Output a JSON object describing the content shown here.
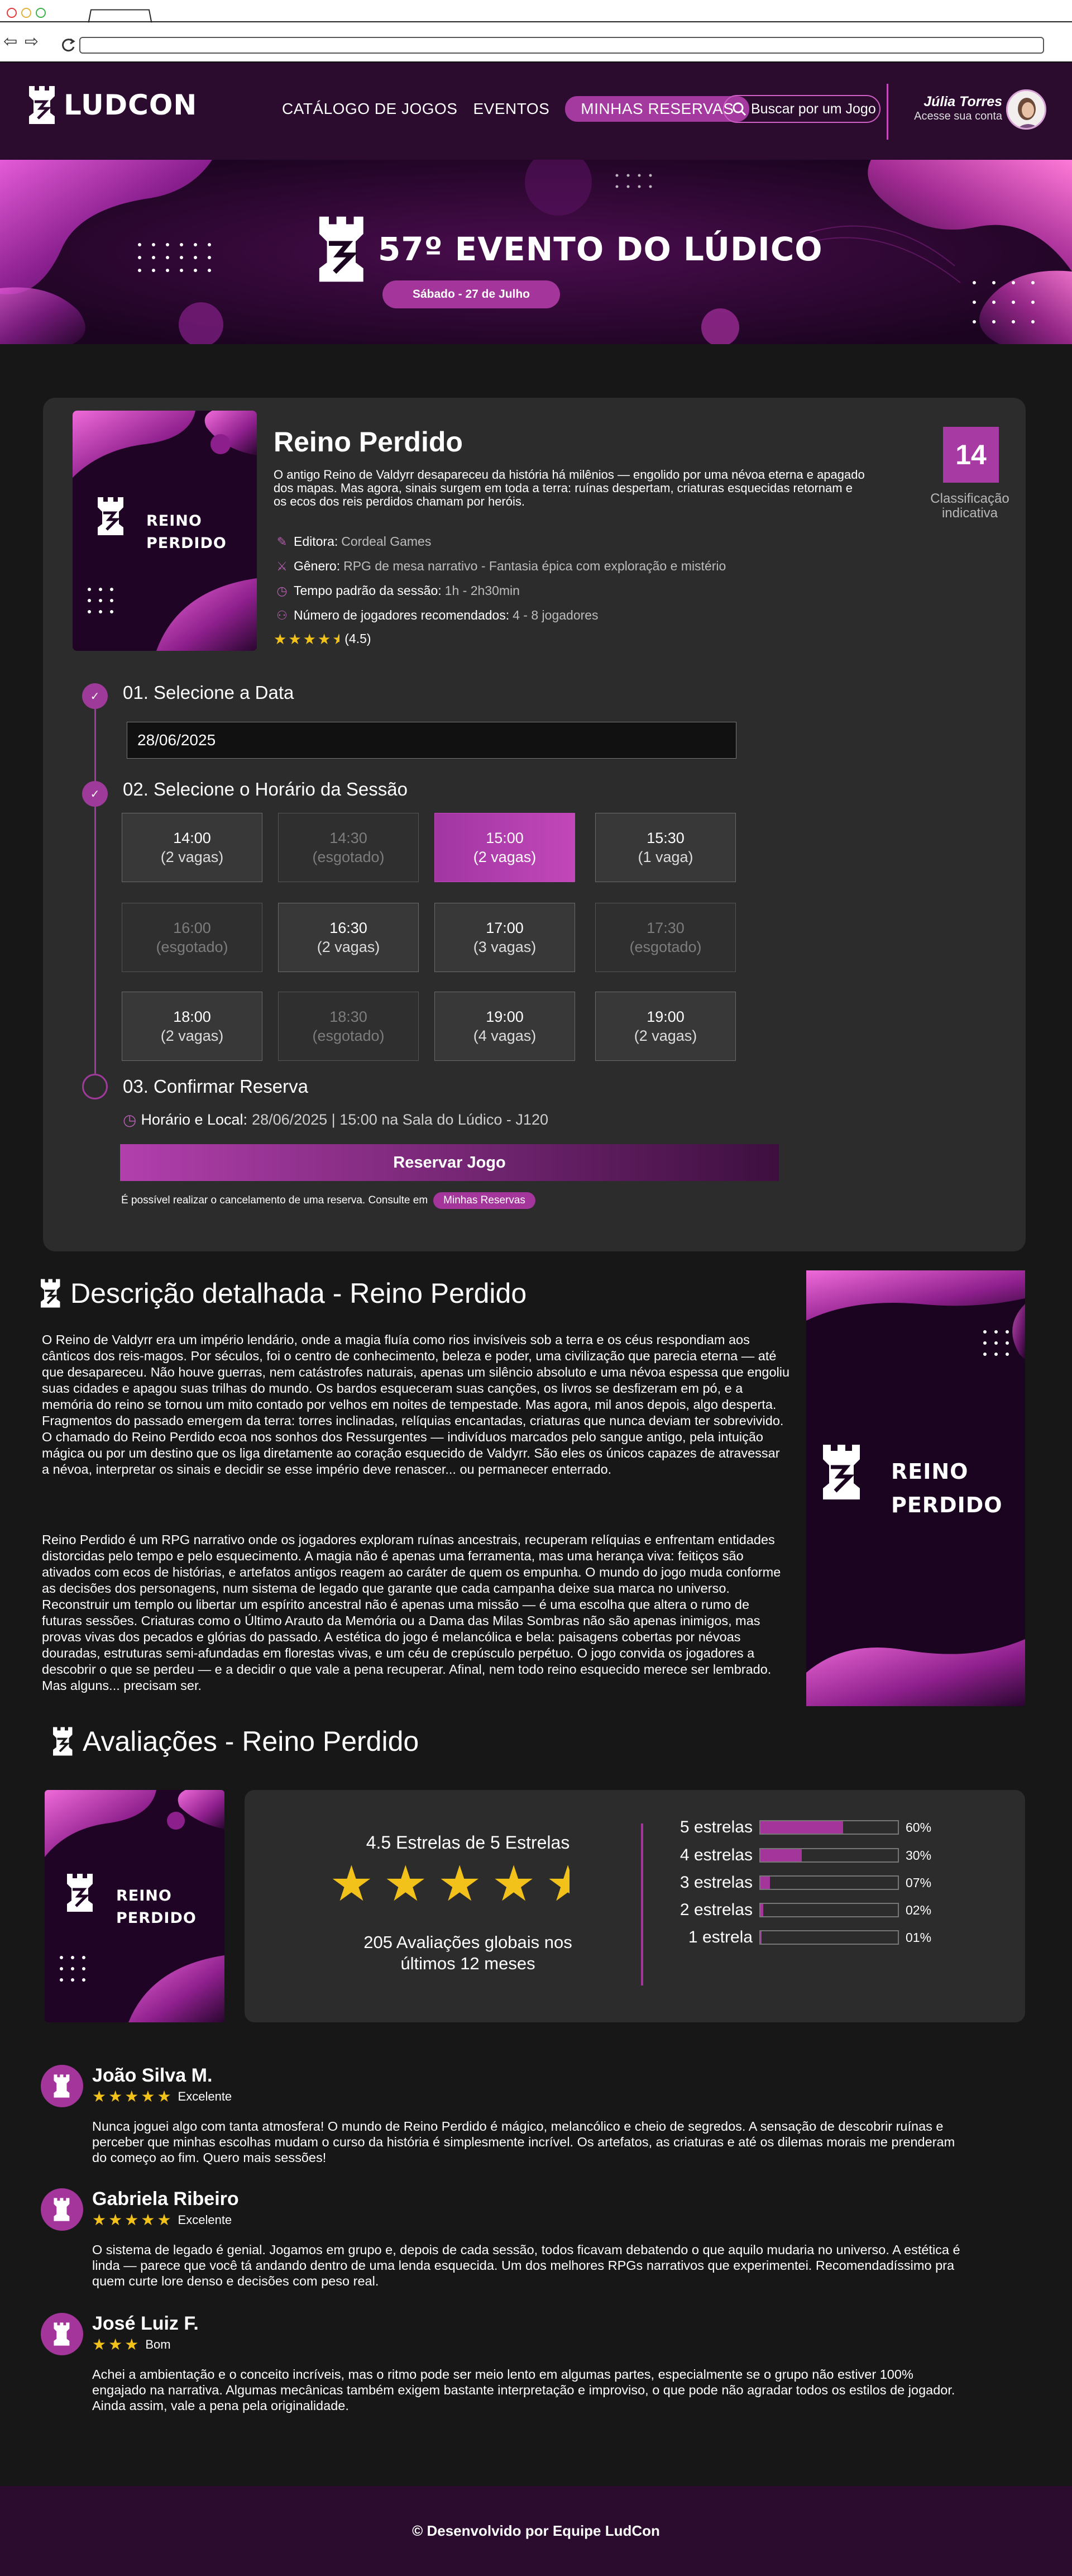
{
  "header": {
    "logo_text": "LUDCON",
    "nav": [
      "CATÁLOGO DE JOGOS",
      "EVENTOS",
      "MINHAS RESERVAS"
    ],
    "search_placeholder": "Buscar por um Jogo",
    "user_name": "Júlia Torres",
    "user_sub": "Acesse sua conta"
  },
  "banner": {
    "title": "57º EVENTO DO LÚDICO",
    "date": "Sábado - 27 de Julho"
  },
  "game": {
    "cover_text": "REINO PERDIDO",
    "cover_line1": "REINO",
    "cover_line2": "PERDIDO",
    "title": "Reino Perdido",
    "description": "O antigo Reino de Valdyrr desapareceu da história há milênios — engolido por uma névoa eterna e apagado dos mapas. Mas agora, sinais surgem em toda a terra: ruínas despertam, criaturas esquecidas retornam e os ecos dos reis perdidos chamam por heróis.",
    "publisher_label": "Editora:",
    "publisher": "Cordeal Games",
    "genre_label": "Gênero:",
    "genre": "RPG de mesa narrativo - Fantasia épica com exploração e mistério",
    "time_label": "Tempo padrão da sessão:",
    "time": "1h - 2h30min",
    "players_label": "Número de jogadores recomendados:",
    "players": "4 - 8 jogadores",
    "rating": 4.5,
    "rating_text": "(4.5)",
    "age": "14",
    "age_label": "Classificação indicativa"
  },
  "booking": {
    "step1": "01. Selecione a Data",
    "date_value": "28/06/2025",
    "step2": "02. Selecione o Horário da Sessão",
    "slots": [
      {
        "time": "14:00",
        "info": "(2 vagas)",
        "state": "available"
      },
      {
        "time": "14:30",
        "info": "(esgotado)",
        "state": "out"
      },
      {
        "time": "15:00",
        "info": "(2 vagas)",
        "state": "selected"
      },
      {
        "time": "15:30",
        "info": "(1 vaga)",
        "state": "available"
      },
      {
        "time": "16:00",
        "info": "(esgotado)",
        "state": "out"
      },
      {
        "time": "16:30",
        "info": "(2 vagas)",
        "state": "available"
      },
      {
        "time": "17:00",
        "info": "(3 vagas)",
        "state": "available"
      },
      {
        "time": "17:30",
        "info": "(esgotado)",
        "state": "out"
      },
      {
        "time": "18:00",
        "info": "(2 vagas)",
        "state": "available"
      },
      {
        "time": "18:30",
        "info": "(esgotado)",
        "state": "out"
      },
      {
        "time": "19:00",
        "info": "(4 vagas)",
        "state": "available"
      },
      {
        "time": "19:00",
        "info": "(2 vagas)",
        "state": "available"
      }
    ],
    "step3": "03. Confirmar Reserva",
    "confirm_label": "Horário e Local:",
    "confirm_value": "28/06/2025 | 15:00 na Sala do Lúdico - J120",
    "button": "Reservar Jogo",
    "cancel_note": "É possível realizar o cancelamento de uma reserva. Consulte em",
    "cancel_link": "Minhas Reservas"
  },
  "description": {
    "title": "Descrição detalhada - Reino Perdido",
    "p1": "O Reino de Valdyrr era um império lendário, onde a magia fluía como rios invisíveis sob a terra e os céus respondiam aos cânticos dos reis-magos. Por séculos, foi o centro de conhecimento, beleza e poder, uma civilização que parecia eterna — até que desapareceu. Não houve guerras, nem catástrofes naturais, apenas um silêncio absoluto e uma névoa espessa que engoliu suas cidades e apagou suas trilhas do mundo. Os bardos esqueceram suas canções, os livros se desfizeram em pó, e a memória do reino se tornou um mito contado por velhos em noites de tempestade. Mas agora, mil anos depois, algo desperta. Fragmentos do passado emergem da terra: torres inclinadas, relíquias encantadas, criaturas que nunca deviam ter sobrevivido. O chamado do Reino Perdido ecoa nos sonhos dos Ressurgentes — indivíduos marcados pelo sangue antigo, pela intuição mágica ou por um destino que os liga diretamente ao coração esquecido de Valdyrr. São eles os únicos capazes de atravessar a névoa, interpretar os sinais e decidir se esse império deve renascer... ou permanecer enterrado.",
    "p2": "Reino Perdido é um RPG narrativo onde os jogadores exploram ruínas ancestrais, recuperam relíquias e enfrentam entidades distorcidas pelo tempo e pelo esquecimento. A magia não é apenas uma ferramenta, mas uma herança viva: feitiços são ativados com ecos de histórias, e artefatos antigos reagem ao caráter de quem os empunha. O mundo do jogo muda conforme as decisões dos personagens, num sistema de legado que garante que cada campanha deixe sua marca no universo. Reconstruir um templo ou libertar um espírito ancestral não é apenas uma missão — é uma escolha que altera o rumo de futuras sessões. Criaturas como o Último Arauto da Memória ou a Dama das Milas Sombras não são apenas inimigos, mas provas vivas dos pecados e glórias do passado. A estética do jogo é melancólica e bela: paisagens cobertas por névoas douradas, estruturas semi-afundadas em florestas vivas, e um céu de crepúsculo perpétuo. O jogo convida os jogadores a descobrir o que se perdeu — e a decidir o que vale a pena recuperar. Afinal, nem todo reino esquecido merece ser lembrado. Mas alguns... precisam ser."
  },
  "reviews": {
    "title": "Avaliações - Reino Perdido",
    "summary_head": "4.5 Estrelas de 5 Estrelas",
    "summary_count": "205 Avaliações globais nos últimos 12 meses",
    "distribution": [
      {
        "label": "5 estrelas",
        "pct": 60,
        "pct_text": "60%"
      },
      {
        "label": "4 estrelas",
        "pct": 30,
        "pct_text": "30%"
      },
      {
        "label": "3 estrelas",
        "pct": 7,
        "pct_text": "07%"
      },
      {
        "label": "2 estrelas",
        "pct": 2,
        "pct_text": "02%"
      },
      {
        "label": "1 estrela",
        "pct": 1,
        "pct_text": "01%"
      }
    ],
    "items": [
      {
        "name": "João Silva M.",
        "stars": 5,
        "verdict": "Excelente",
        "text": "Nunca joguei algo com tanta atmosfera! O mundo de Reino Perdido é mágico, melancólico e cheio de segredos. A sensação de descobrir ruínas e perceber que minhas escolhas mudam o curso da história é simplesmente incrível. Os artefatos, as criaturas e até os dilemas morais me prenderam do começo ao fim. Quero mais sessões!"
      },
      {
        "name": "Gabriela Ribeiro",
        "stars": 5,
        "verdict": "Excelente",
        "text": "O sistema de legado é genial. Jogamos em grupo e, depois de cada sessão, todos ficavam debatendo o que aquilo mudaria no universo. A estética é linda — parece que você tá andando dentro de uma lenda esquecida. Um dos melhores RPGs narrativos que experimentei. Recomendadíssimo pra quem curte lore denso e decisões com peso real."
      },
      {
        "name": "José Luiz F.",
        "stars": 3,
        "verdict": "Bom",
        "text": "Achei a ambientação e o conceito incríveis, mas o ritmo pode ser meio lento em algumas partes, especialmente se o grupo não estiver 100% engajado na narrativa. Algumas mecânicas também exigem bastante interpretação e improviso, o que pode não agradar todos os estilos de jogador. Ainda assim, vale a pena pela originalidade."
      }
    ]
  },
  "footer": {
    "text": "© Desenvolvido por Equipe LudCon"
  },
  "colors": {
    "accent": "#a3359b",
    "header_bg": "#2b0c2f",
    "card_bg": "#2c2c2c",
    "star": "#f2c21b"
  }
}
